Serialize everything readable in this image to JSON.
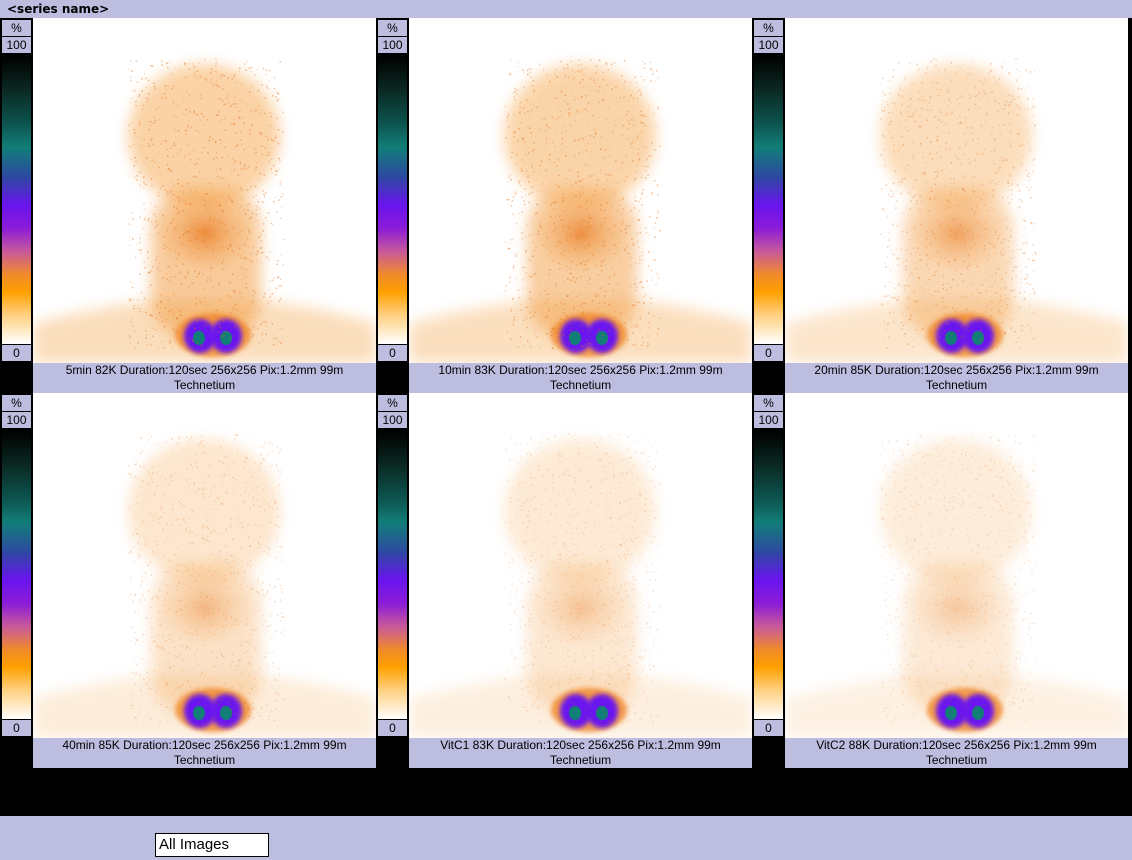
{
  "series": {
    "name": "<series name>"
  },
  "colorbar": {
    "unit": "%",
    "max": "100",
    "min": "0"
  },
  "panels": [
    {
      "line1": "5min 82K Duration:120sec 256x256 Pix:1.2mm 99m",
      "line2": "Technetium",
      "intensity": 1.0,
      "selected": false
    },
    {
      "line1": "10min 83K Duration:120sec 256x256 Pix:1.2mm 99m",
      "line2": "Technetium",
      "intensity": 0.95,
      "selected": false
    },
    {
      "line1": "20min 85K Duration:120sec 256x256 Pix:1.2mm 99m",
      "line2": "Technetium",
      "intensity": 0.75,
      "selected": false
    },
    {
      "line1": "40min 85K Duration:120sec 256x256 Pix:1.2mm 99m",
      "line2": "Technetium",
      "intensity": 0.55,
      "selected": false
    },
    {
      "line1": "VitC1 83K Duration:120sec 256x256 Pix:1.2mm 99m",
      "line2": "Technetium",
      "intensity": 0.45,
      "selected": false
    },
    {
      "line1": "VitC2 88K Duration:120sec 256x256 Pix:1.2mm 99m",
      "line2": "Technetium",
      "intensity": 0.4,
      "selected": true
    }
  ],
  "toolbar": {
    "view_select": "All Images"
  },
  "colors": {
    "ui_bg": "#bdbde0",
    "background": "#000000",
    "select_border": "#c0304a",
    "uptake": "#f08a2a",
    "hot": "#6a14ee"
  }
}
